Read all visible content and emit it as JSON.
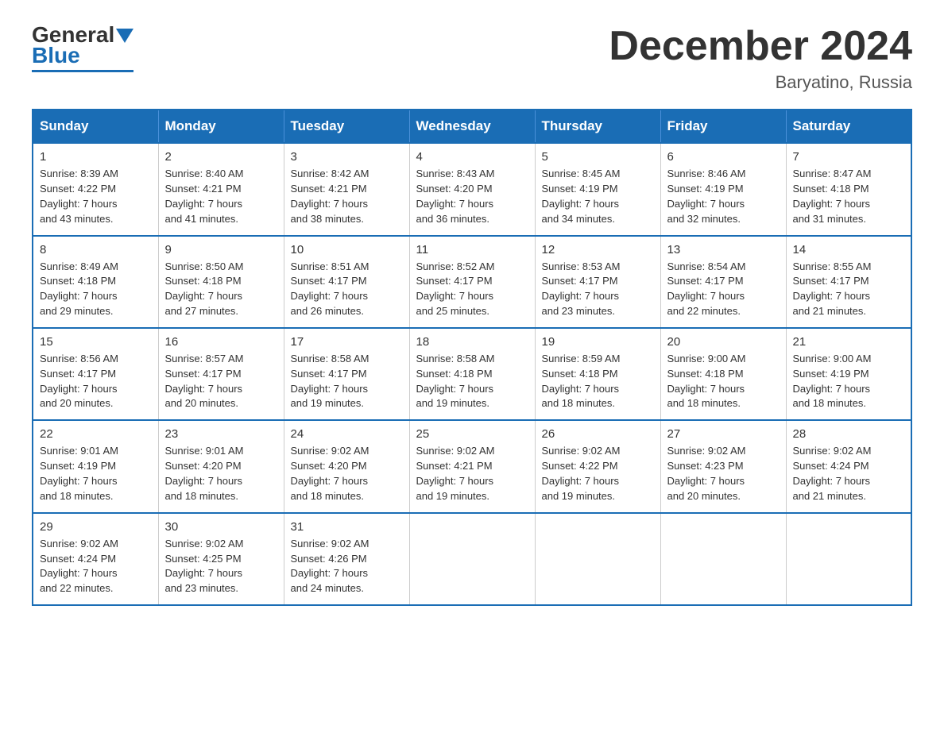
{
  "logo": {
    "general": "General",
    "blue": "Blue"
  },
  "title": "December 2024",
  "location": "Baryatino, Russia",
  "days_of_week": [
    "Sunday",
    "Monday",
    "Tuesday",
    "Wednesday",
    "Thursday",
    "Friday",
    "Saturday"
  ],
  "weeks": [
    [
      {
        "day": "1",
        "info": "Sunrise: 8:39 AM\nSunset: 4:22 PM\nDaylight: 7 hours\nand 43 minutes."
      },
      {
        "day": "2",
        "info": "Sunrise: 8:40 AM\nSunset: 4:21 PM\nDaylight: 7 hours\nand 41 minutes."
      },
      {
        "day": "3",
        "info": "Sunrise: 8:42 AM\nSunset: 4:21 PM\nDaylight: 7 hours\nand 38 minutes."
      },
      {
        "day": "4",
        "info": "Sunrise: 8:43 AM\nSunset: 4:20 PM\nDaylight: 7 hours\nand 36 minutes."
      },
      {
        "day": "5",
        "info": "Sunrise: 8:45 AM\nSunset: 4:19 PM\nDaylight: 7 hours\nand 34 minutes."
      },
      {
        "day": "6",
        "info": "Sunrise: 8:46 AM\nSunset: 4:19 PM\nDaylight: 7 hours\nand 32 minutes."
      },
      {
        "day": "7",
        "info": "Sunrise: 8:47 AM\nSunset: 4:18 PM\nDaylight: 7 hours\nand 31 minutes."
      }
    ],
    [
      {
        "day": "8",
        "info": "Sunrise: 8:49 AM\nSunset: 4:18 PM\nDaylight: 7 hours\nand 29 minutes."
      },
      {
        "day": "9",
        "info": "Sunrise: 8:50 AM\nSunset: 4:18 PM\nDaylight: 7 hours\nand 27 minutes."
      },
      {
        "day": "10",
        "info": "Sunrise: 8:51 AM\nSunset: 4:17 PM\nDaylight: 7 hours\nand 26 minutes."
      },
      {
        "day": "11",
        "info": "Sunrise: 8:52 AM\nSunset: 4:17 PM\nDaylight: 7 hours\nand 25 minutes."
      },
      {
        "day": "12",
        "info": "Sunrise: 8:53 AM\nSunset: 4:17 PM\nDaylight: 7 hours\nand 23 minutes."
      },
      {
        "day": "13",
        "info": "Sunrise: 8:54 AM\nSunset: 4:17 PM\nDaylight: 7 hours\nand 22 minutes."
      },
      {
        "day": "14",
        "info": "Sunrise: 8:55 AM\nSunset: 4:17 PM\nDaylight: 7 hours\nand 21 minutes."
      }
    ],
    [
      {
        "day": "15",
        "info": "Sunrise: 8:56 AM\nSunset: 4:17 PM\nDaylight: 7 hours\nand 20 minutes."
      },
      {
        "day": "16",
        "info": "Sunrise: 8:57 AM\nSunset: 4:17 PM\nDaylight: 7 hours\nand 20 minutes."
      },
      {
        "day": "17",
        "info": "Sunrise: 8:58 AM\nSunset: 4:17 PM\nDaylight: 7 hours\nand 19 minutes."
      },
      {
        "day": "18",
        "info": "Sunrise: 8:58 AM\nSunset: 4:18 PM\nDaylight: 7 hours\nand 19 minutes."
      },
      {
        "day": "19",
        "info": "Sunrise: 8:59 AM\nSunset: 4:18 PM\nDaylight: 7 hours\nand 18 minutes."
      },
      {
        "day": "20",
        "info": "Sunrise: 9:00 AM\nSunset: 4:18 PM\nDaylight: 7 hours\nand 18 minutes."
      },
      {
        "day": "21",
        "info": "Sunrise: 9:00 AM\nSunset: 4:19 PM\nDaylight: 7 hours\nand 18 minutes."
      }
    ],
    [
      {
        "day": "22",
        "info": "Sunrise: 9:01 AM\nSunset: 4:19 PM\nDaylight: 7 hours\nand 18 minutes."
      },
      {
        "day": "23",
        "info": "Sunrise: 9:01 AM\nSunset: 4:20 PM\nDaylight: 7 hours\nand 18 minutes."
      },
      {
        "day": "24",
        "info": "Sunrise: 9:02 AM\nSunset: 4:20 PM\nDaylight: 7 hours\nand 18 minutes."
      },
      {
        "day": "25",
        "info": "Sunrise: 9:02 AM\nSunset: 4:21 PM\nDaylight: 7 hours\nand 19 minutes."
      },
      {
        "day": "26",
        "info": "Sunrise: 9:02 AM\nSunset: 4:22 PM\nDaylight: 7 hours\nand 19 minutes."
      },
      {
        "day": "27",
        "info": "Sunrise: 9:02 AM\nSunset: 4:23 PM\nDaylight: 7 hours\nand 20 minutes."
      },
      {
        "day": "28",
        "info": "Sunrise: 9:02 AM\nSunset: 4:24 PM\nDaylight: 7 hours\nand 21 minutes."
      }
    ],
    [
      {
        "day": "29",
        "info": "Sunrise: 9:02 AM\nSunset: 4:24 PM\nDaylight: 7 hours\nand 22 minutes."
      },
      {
        "day": "30",
        "info": "Sunrise: 9:02 AM\nSunset: 4:25 PM\nDaylight: 7 hours\nand 23 minutes."
      },
      {
        "day": "31",
        "info": "Sunrise: 9:02 AM\nSunset: 4:26 PM\nDaylight: 7 hours\nand 24 minutes."
      },
      {
        "day": "",
        "info": ""
      },
      {
        "day": "",
        "info": ""
      },
      {
        "day": "",
        "info": ""
      },
      {
        "day": "",
        "info": ""
      }
    ]
  ]
}
